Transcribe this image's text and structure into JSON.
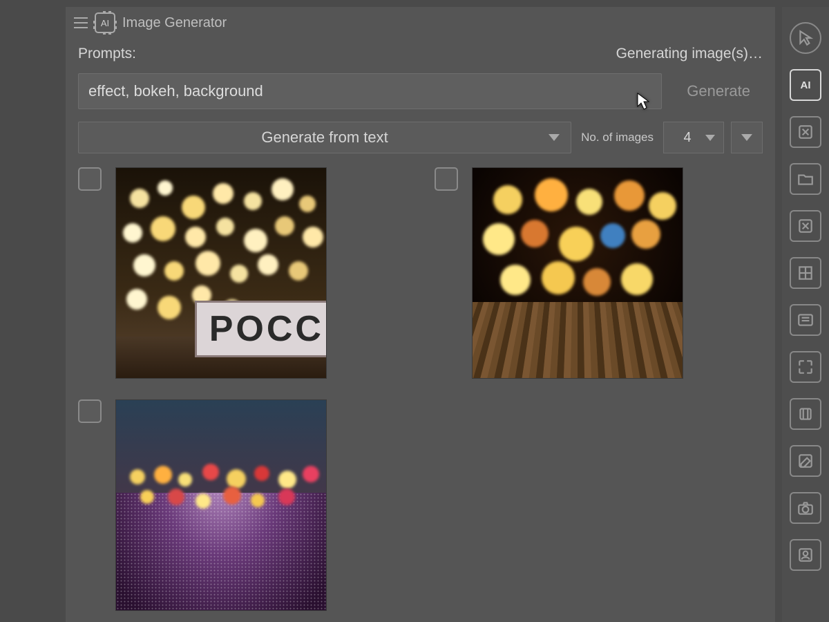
{
  "titlebar": {
    "title": "Image Generator"
  },
  "promptsRow": {
    "label": "Prompts:",
    "status": "Generating image(s)…"
  },
  "input": {
    "value": "effect, bokeh, background",
    "generateLabel": "Generate"
  },
  "controls": {
    "modeLabel": "Generate from text",
    "numLabel": "No. of images",
    "numValue": "4"
  },
  "results": {
    "count": 3,
    "items": [
      {
        "checked": false,
        "overlayText": "POCC"
      },
      {
        "checked": false
      },
      {
        "checked": false
      }
    ]
  },
  "sidebar": {
    "items": [
      {
        "name": "pointer-icon"
      },
      {
        "name": "ai-icon",
        "label": "AI",
        "active": true
      },
      {
        "name": "close-layer-icon"
      },
      {
        "name": "folder-icon"
      },
      {
        "name": "delete-box-icon"
      },
      {
        "name": "grid-icon"
      },
      {
        "name": "gallery-icon"
      },
      {
        "name": "expand-icon"
      },
      {
        "name": "library-icon"
      },
      {
        "name": "edit-square-icon"
      },
      {
        "name": "camera-icon"
      },
      {
        "name": "person-icon"
      }
    ]
  }
}
